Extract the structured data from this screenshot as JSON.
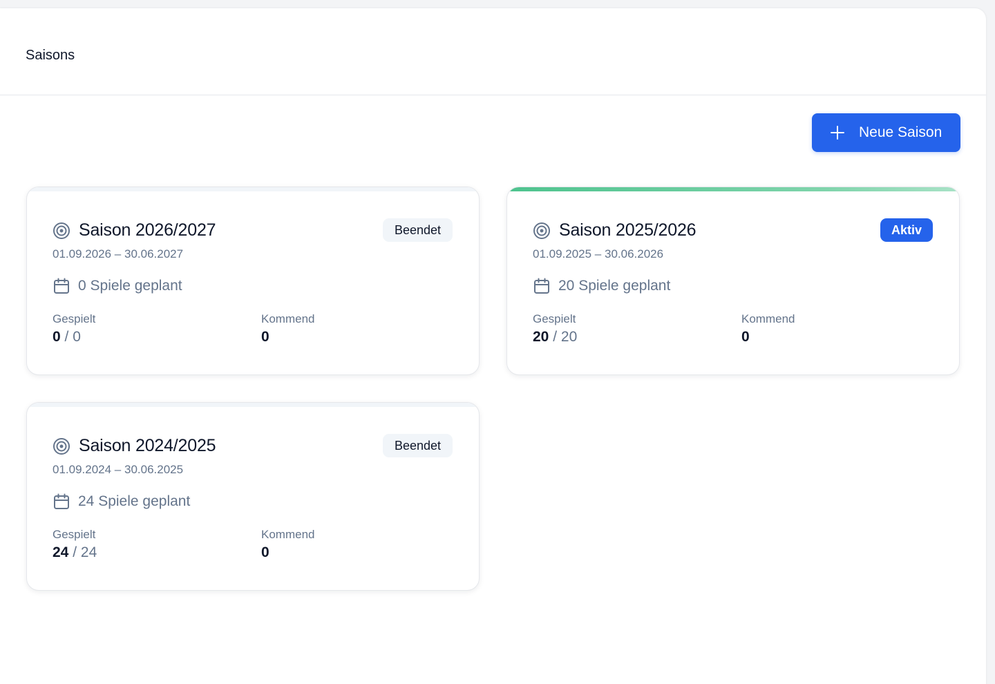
{
  "page": {
    "title": "Saisons"
  },
  "toolbar": {
    "new_season_label": "Neue Saison",
    "new_season_icon": "plus-icon"
  },
  "colors": {
    "primary": "#2563eb",
    "active_bar": "#4ec38e",
    "muted_text": "#64748b"
  },
  "labels": {
    "played": "Gespielt",
    "upcoming": "Kommend",
    "separator": "/"
  },
  "seasons": [
    {
      "title": "Saison 2026/2027",
      "date_range": "01.09.2026 – 30.06.2027",
      "games_planned": "0 Spiele geplant",
      "status": "Beendet",
      "played": "0",
      "played_total": "0",
      "upcoming": "0"
    },
    {
      "title": "Saison 2025/2026",
      "date_range": "01.09.2025 – 30.06.2026",
      "games_planned": "20 Spiele geplant",
      "status": "Aktiv",
      "played": "20",
      "played_total": "20",
      "upcoming": "0"
    },
    {
      "title": "Saison 2024/2025",
      "date_range": "01.09.2024 – 30.06.2025",
      "games_planned": "24 Spiele geplant",
      "status": "Beendet",
      "played": "24",
      "played_total": "24",
      "upcoming": "0"
    }
  ]
}
